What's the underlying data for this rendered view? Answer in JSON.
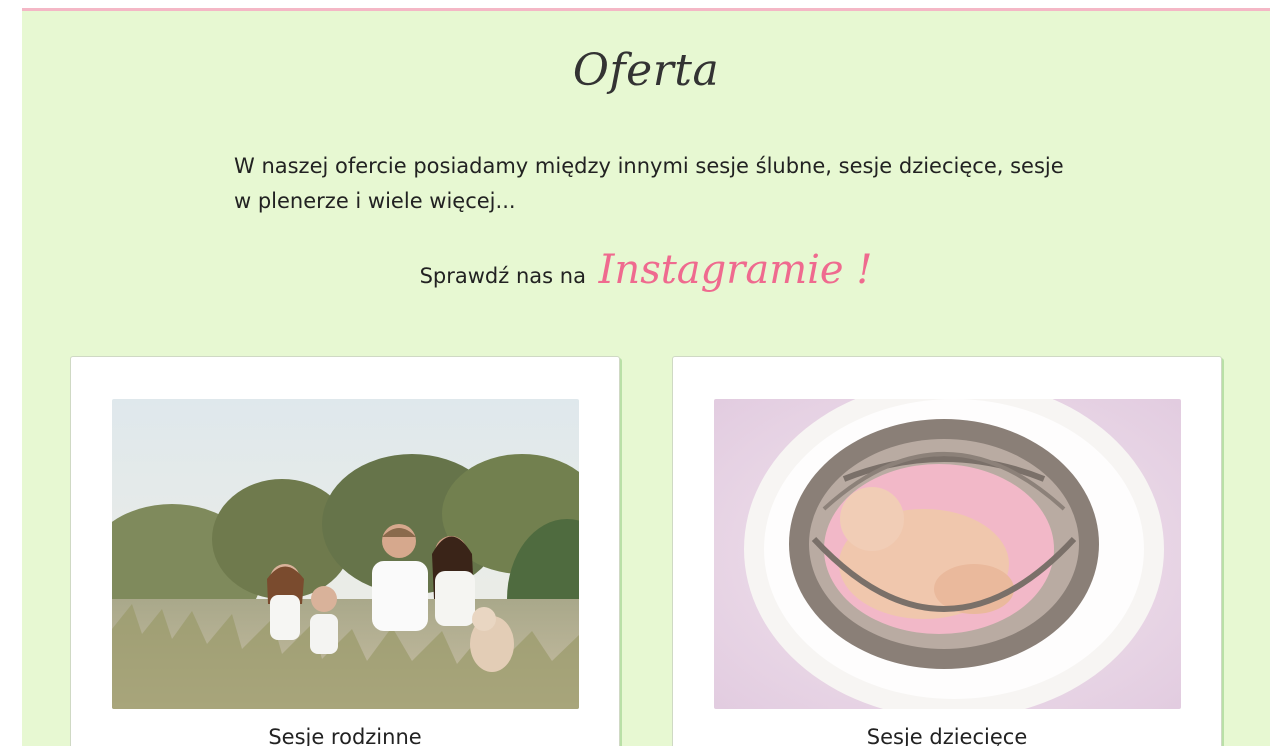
{
  "section": {
    "title": "Oferta",
    "intro": "W naszej ofercie posiadamy między innymi sesje ślubne, sesje dziecięce, sesje w plenerze i wiele więcej...",
    "cta_prefix": "Sprawdź nas na",
    "cta_link": "Instagramie !"
  },
  "cards": [
    {
      "label": "Sesje rodzinne"
    },
    {
      "label": "Sesje dziecięce"
    }
  ],
  "colors": {
    "background": "#e7f8d2",
    "accent": "#ef6a8f",
    "top_border": "#f4b7c6"
  }
}
